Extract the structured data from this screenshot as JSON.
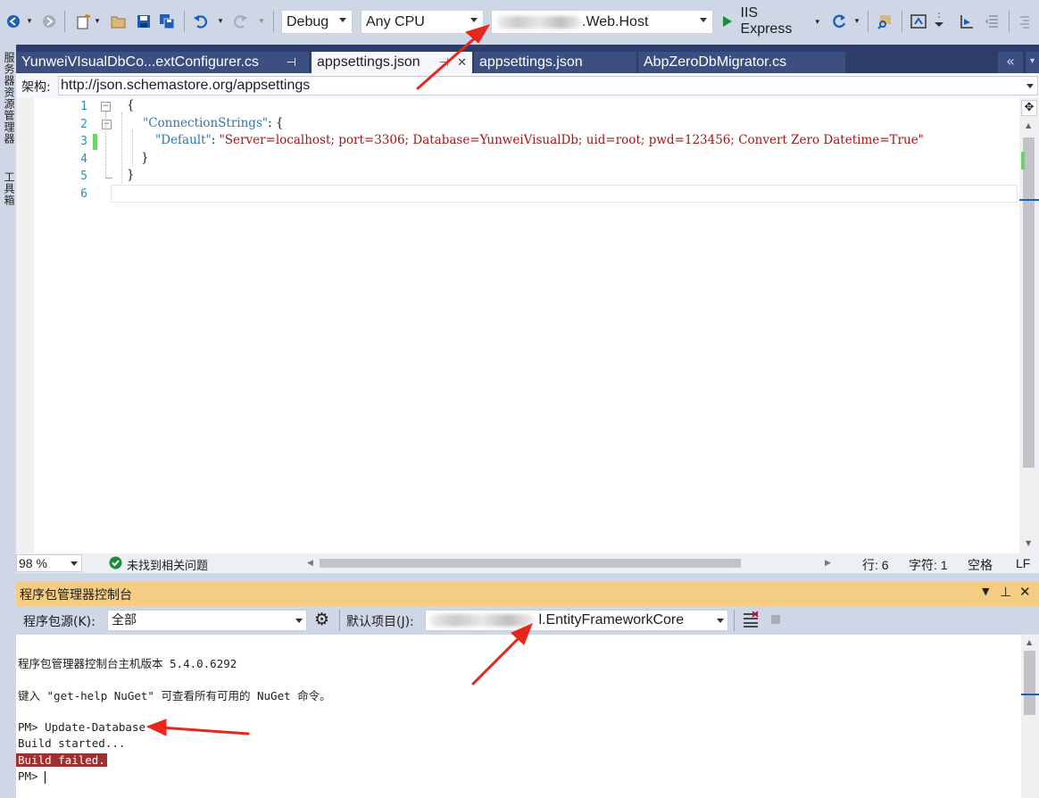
{
  "toolbar": {
    "config": "Debug",
    "platform": "Any CPU",
    "startup_project": ".Web.Host",
    "run_label": "IIS Express"
  },
  "left_strip": {
    "label1": "服务器资源管理器",
    "label2": "工具箱"
  },
  "tabs": [
    {
      "label": "YunweiVIsualDbCo...extConfigurer.cs",
      "pin": "⊣"
    },
    {
      "label": "appsettings.json",
      "pin": "⊣",
      "close": "✕"
    },
    {
      "label": "appsettings.json"
    },
    {
      "label": "AbpZeroDbMigrator.cs"
    }
  ],
  "schema": {
    "label": "架构:",
    "value": "http://json.schemastore.org/appsettings"
  },
  "editor": {
    "line_numbers": [
      "1",
      "2",
      "3",
      "4",
      "5",
      "6"
    ],
    "line1": "{",
    "line2_key": "\"ConnectionStrings\"",
    "line2_rest": ": {",
    "line3_key": "\"Default\"",
    "line3_colon": ": ",
    "line3_value": "\"Server=localhost; port=3306; Database=YunweiVisualDb; uid=root; pwd=123456; Convert Zero Datetime=True\"",
    "line4": "}",
    "line5": "}"
  },
  "editor_status": {
    "zoom": "98 %",
    "issues": "未找到相关问题",
    "line": "行: 6",
    "char": "字符: 1",
    "spaces": "空格",
    "eol": "LF"
  },
  "package_manager": {
    "title": "程序包管理器控制台",
    "source_label": "程序包源(K):",
    "source_value": "全部",
    "default_project_label": "默认项目(J):",
    "default_project_value": "l.EntityFrameworkCore",
    "console_lines": [
      "程序包管理器控制台主机版本 5.4.0.6292",
      "键入 \"get-help NuGet\" 可查看所有可用的 NuGet 命令。",
      "PM> Update-Database",
      "Build started...",
      "Build failed.",
      "PM> "
    ]
  },
  "colors": {
    "tab_bar": "#2d3d6a",
    "tab": "#3d4e81",
    "panel_header": "#f5cc84",
    "annotation_arrow": "#e8261c",
    "build_failed_bg": "#a03030"
  }
}
